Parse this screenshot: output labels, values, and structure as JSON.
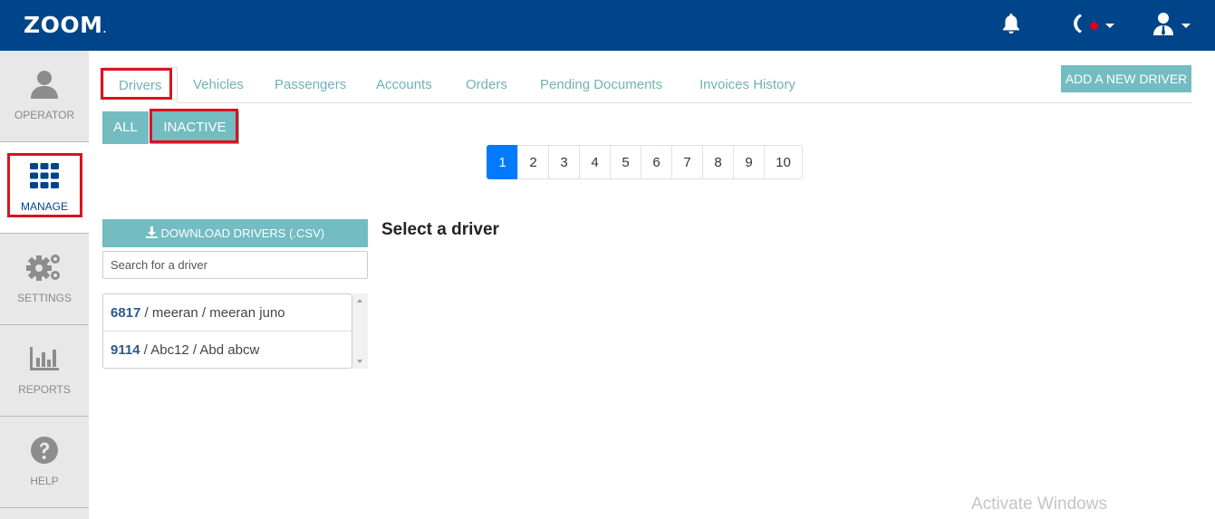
{
  "app": {
    "logo": "ZOOM",
    "logo_dot": ".",
    "brand_color": "#004589",
    "accent_color": "#72bcc2"
  },
  "topbar": {
    "icons": [
      "bell-icon",
      "phone-icon",
      "user-icon"
    ],
    "status_color": "#e0001b"
  },
  "sidebar": {
    "items": [
      {
        "label": "OPERATOR",
        "icon": "user-icon"
      },
      {
        "label": "MANAGE",
        "icon": "grid-icon"
      },
      {
        "label": "SETTINGS",
        "icon": "gears-icon"
      },
      {
        "label": "REPORTS",
        "icon": "bar-chart-icon"
      },
      {
        "label": "HELP",
        "icon": "help-icon"
      }
    ]
  },
  "tabs": [
    {
      "label": "Drivers"
    },
    {
      "label": "Vehicles"
    },
    {
      "label": "Passengers"
    },
    {
      "label": "Accounts"
    },
    {
      "label": "Orders"
    },
    {
      "label": "Pending Documents"
    },
    {
      "label": "Invoices History"
    }
  ],
  "add_button": "ADD A NEW DRIVER",
  "filters": {
    "all": "ALL",
    "inactive": "INACTIVE"
  },
  "pagination": [
    "1",
    "2",
    "3",
    "4",
    "5",
    "6",
    "7",
    "8",
    "9",
    "10"
  ],
  "download_button": "DOWNLOAD DRIVERS (.CSV)",
  "search": {
    "placeholder": "Search for a driver",
    "value": ""
  },
  "drivers": [
    {
      "id": "6817",
      "rest": " / meeran / meeran juno"
    },
    {
      "id": "9114",
      "rest": " / Abc12 / Abd abcw"
    }
  ],
  "detail_title": "Select a driver",
  "watermark": "Activate Windows"
}
